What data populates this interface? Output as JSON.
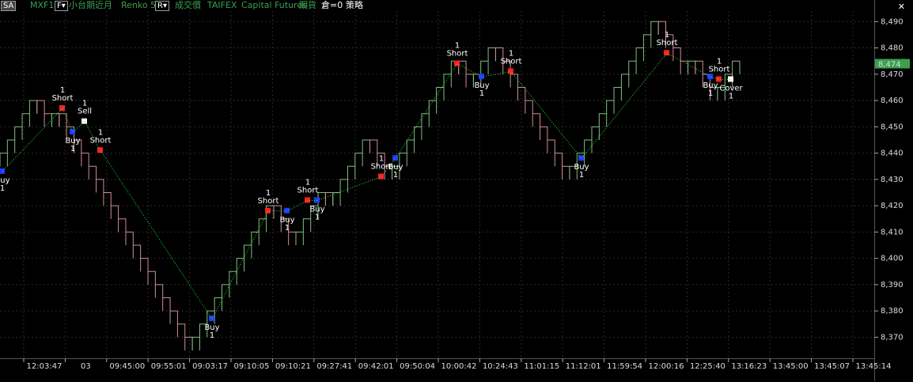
{
  "header": {
    "symbol_box": "SA",
    "code": "MXF1",
    "code_dropdown": "F▾",
    "name": "小台期近月",
    "chart_kind": "Renko 5",
    "mode_dropdown": "R▾",
    "field": "成交價",
    "exchange": "TAIFEX",
    "broker": "Capital Futures",
    "category": "期貨",
    "position": "倉=0",
    "strategy": "策略"
  },
  "current_price_label": "8,474",
  "colors": {
    "up": "#7fbf7f",
    "down": "#d08c96",
    "buy": "#1f3bff",
    "short": "#ff2020",
    "link": "#2ee62e",
    "current_price": "#3aa050"
  },
  "chart_data": {
    "type": "renko",
    "box_size": 5,
    "ylim": [
      8362,
      8494
    ],
    "y_ticks": [
      8370,
      8380,
      8390,
      8400,
      8410,
      8420,
      8430,
      8440,
      8450,
      8460,
      8470,
      8480,
      8490
    ],
    "y_tick_labels": [
      "8,370",
      "8,380",
      "8,390",
      "8,400",
      "8,410",
      "8,420",
      "8,430",
      "8,440",
      "8,450",
      "8,460",
      "8,470",
      "8,480",
      "8,490"
    ],
    "x_tick_labels": [
      "12:03:47",
      "03",
      "09:45:00",
      "09:55:01",
      "09:03:17",
      "09:10:05",
      "09:10:21",
      "09:27:41",
      "09:42:01",
      "09:50:04",
      "10:00:42",
      "10:24:43",
      "11:01:15",
      "11:12:01",
      "11:59:54",
      "12:00:16",
      "12:25:40",
      "13:16:23",
      "13:45:00",
      "13:45:07",
      "13:45:14"
    ],
    "grid": true,
    "bricks_legs": [
      8435,
      8460,
      8450,
      8455,
      8440,
      8365,
      8420,
      8405,
      8425,
      8420,
      8445,
      8430,
      8475,
      8465,
      8480,
      8465,
      8430,
      8490,
      8470,
      8475,
      8460,
      8475
    ],
    "signals": [
      {
        "label": "Buy",
        "qty": "1",
        "price": 8433
      },
      {
        "label": "Short",
        "qty": "1",
        "price": 8457
      },
      {
        "label": "Buy",
        "qty": "1",
        "price": 8448
      },
      {
        "label": "Sell",
        "qty": "1",
        "price": 8452
      },
      {
        "label": "Short",
        "qty": "1",
        "price": 8441
      },
      {
        "label": "Buy",
        "qty": "1",
        "price": 8377
      },
      {
        "label": "Short",
        "qty": "1",
        "price": 8418
      },
      {
        "label": "Buy",
        "qty": "1",
        "price": 8418
      },
      {
        "label": "Short",
        "qty": "1",
        "price": 8422
      },
      {
        "label": "Buy",
        "qty": "1",
        "price": 8422
      },
      {
        "label": "Short",
        "qty": "1",
        "price": 8431
      },
      {
        "label": "Buy",
        "qty": "1",
        "price": 8438
      },
      {
        "label": "Short",
        "qty": "1",
        "price": 8474
      },
      {
        "label": "Buy",
        "qty": "1",
        "price": 8469
      },
      {
        "label": "Short",
        "qty": "1",
        "price": 8471
      },
      {
        "label": "Buy",
        "qty": "1",
        "price": 8438
      },
      {
        "label": "Short",
        "qty": "1",
        "price": 8478
      },
      {
        "label": "Buy",
        "qty": "1",
        "price": 8469
      },
      {
        "label": "Short",
        "qty": "1",
        "price": 8468
      },
      {
        "label": "Cover",
        "qty": "1",
        "price": 8468
      }
    ]
  }
}
